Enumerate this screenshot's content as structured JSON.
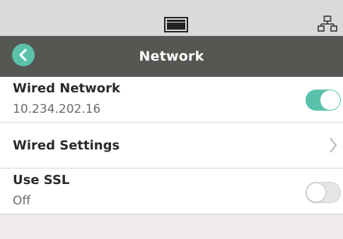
{
  "status_bar": {
    "center_icon": "display-icon",
    "right_icon": "network-icon"
  },
  "header": {
    "title": "Network",
    "back_icon": "chevron-left-icon"
  },
  "rows": [
    {
      "title": "Wired Network",
      "subtitle": "10.234.202.16",
      "control": "toggle",
      "toggle_on": true
    },
    {
      "title": "Wired Settings",
      "control": "chevron",
      "chevron_icon": "chevron-right-icon"
    },
    {
      "title": "Use SSL",
      "subtitle": "Off",
      "control": "toggle",
      "toggle_on": false
    }
  ],
  "colors": {
    "accent": "#5ac2aa",
    "header_bg": "#555753",
    "status_bg": "#dadada",
    "page_bg": "#efebec"
  }
}
